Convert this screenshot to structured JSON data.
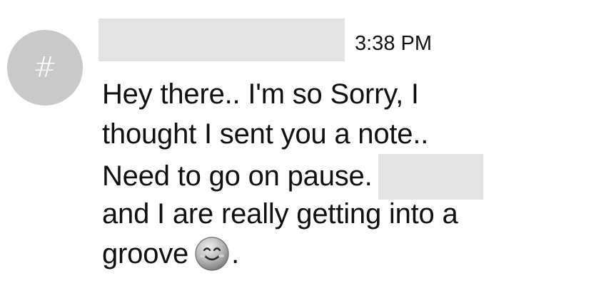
{
  "message": {
    "timestamp": "3:38 PM",
    "avatar_glyph": "#",
    "lines": [
      "Hey there.. I'm so Sorry, I",
      "thought I sent you a note..",
      "Need to go on pause.",
      "and I are really getting into a",
      "groove",
      "."
    ],
    "emoji": "smiling-face-icon"
  }
}
